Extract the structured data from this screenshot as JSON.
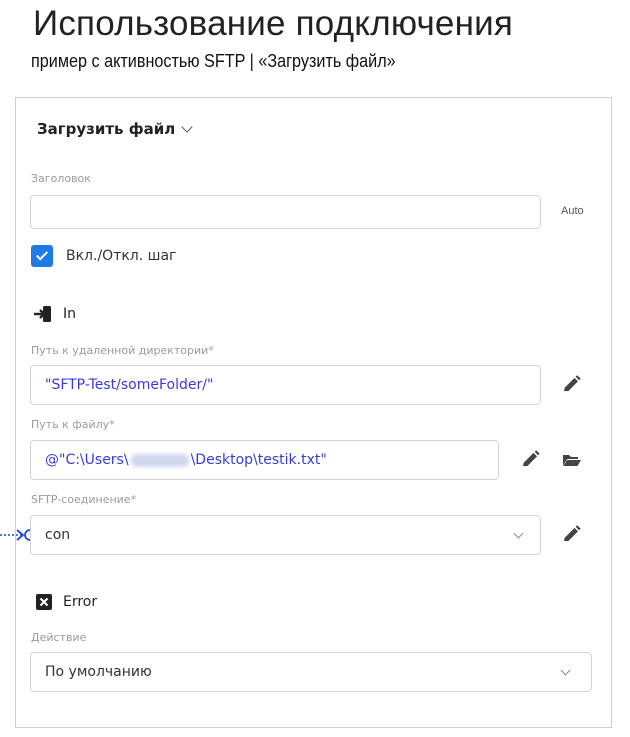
{
  "slide": {
    "title": "Использование подключения",
    "subtitle": "пример с активностью SFTP | «Загрузить файл»"
  },
  "activity": {
    "name": "Загрузить файл",
    "header_label": "Заголовок",
    "header_value": "",
    "auto_label": "Auto",
    "step_toggle_label": "Вкл./Откл. шаг",
    "step_toggle_checked": true
  },
  "in_section": {
    "title": "In",
    "remote_dir_label": "Путь к удаленной директории*",
    "remote_dir_value": "\"SFTP-Test/someFolder/\"",
    "file_path_label": "Путь к файлу*",
    "file_path_prefix": "@\"C:\\Users\\",
    "file_path_suffix": "\\Desktop\\testik.txt\"",
    "connection_label": "SFTP-соединение*",
    "connection_value": "con"
  },
  "error_section": {
    "title": "Error",
    "action_label": "Действие",
    "action_value": "По умолчанию"
  },
  "colors": {
    "accent": "#1e7be6",
    "expression_text": "#3a3adb",
    "connector": "#2346d6"
  },
  "icons": [
    "chevron-down-icon",
    "checkbox-checked-icon",
    "input-arrow-icon",
    "pencil-icon",
    "folder-open-icon",
    "close-box-icon",
    "connector-circle-icon"
  ]
}
